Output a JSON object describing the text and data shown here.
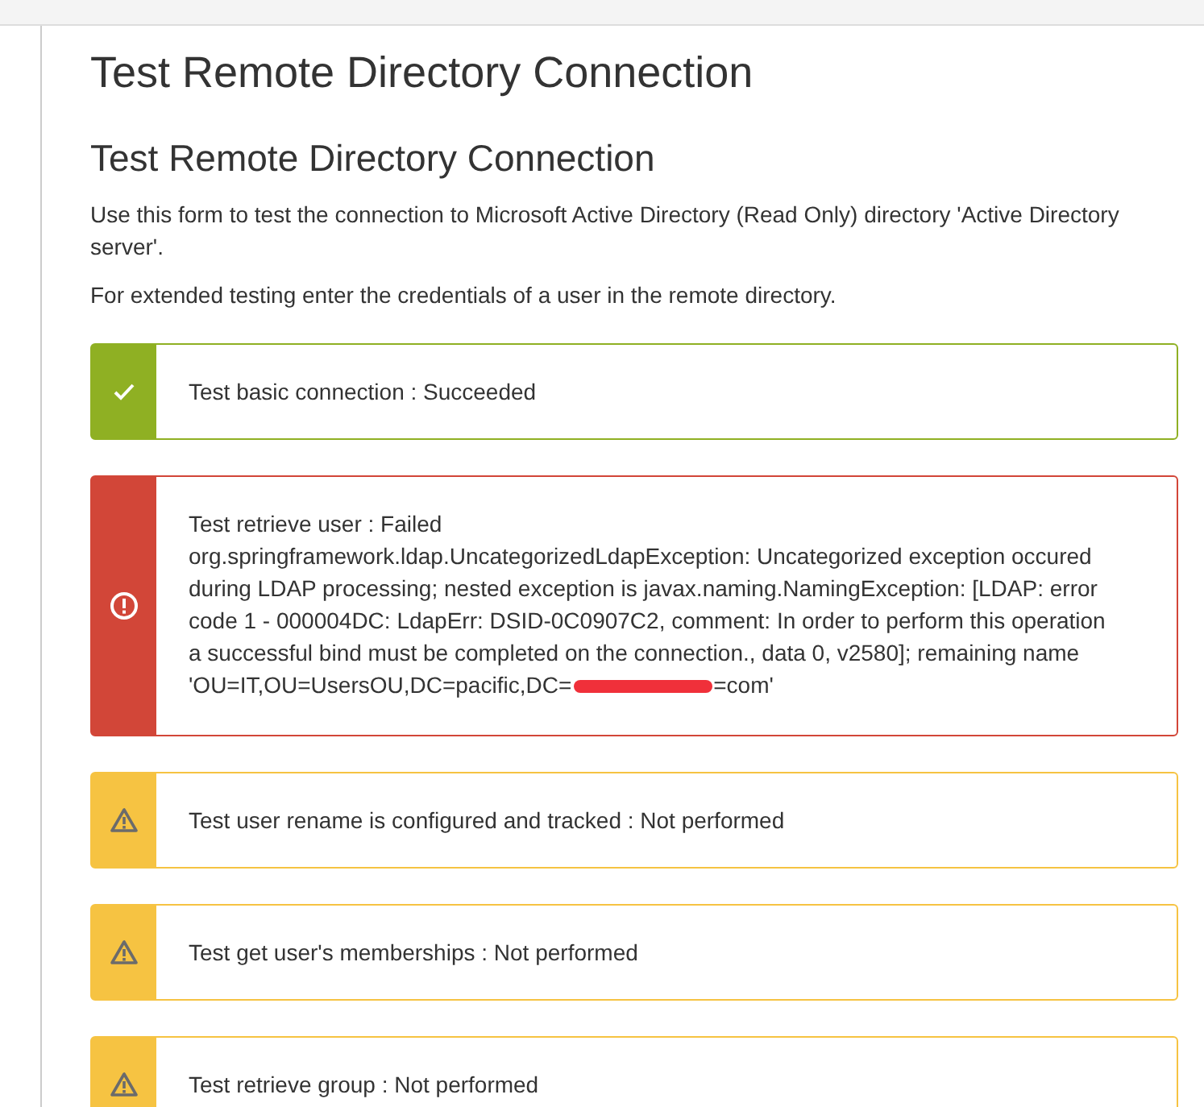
{
  "page_title": "Test Remote Directory Connection",
  "section_title": "Test Remote Directory Connection",
  "intro": [
    "Use this form to test the connection to Microsoft Active Directory (Read Only) directory 'Active Directory server'.",
    "For extended testing enter the credentials of a user in the remote directory."
  ],
  "results": [
    {
      "kind": "success",
      "message": "Test basic connection : Succeeded"
    },
    {
      "kind": "error",
      "message": "Test retrieve user : Failed",
      "detail_before": "org.springframework.ldap.UncategorizedLdapException: Uncategorized exception occured during LDAP processing; nested exception is javax.naming.NamingException: [LDAP: error code 1 - 000004DC: LdapErr: DSID-0C0907C2, comment: In order to perform this operation a successful bind must be completed on the connection., data 0, v2580]; remaining name",
      "detail_last": "'OU=IT,OU=UsersOU,DC=pacific,DC=",
      "redacted": true,
      "detail_after": "=com'"
    },
    {
      "kind": "warning",
      "message": "Test user rename is configured and tracked : Not performed"
    },
    {
      "kind": "warning",
      "message": "Test get user's memberships : Not performed"
    },
    {
      "kind": "warning",
      "message": "Test retrieve group : Not performed"
    }
  ]
}
